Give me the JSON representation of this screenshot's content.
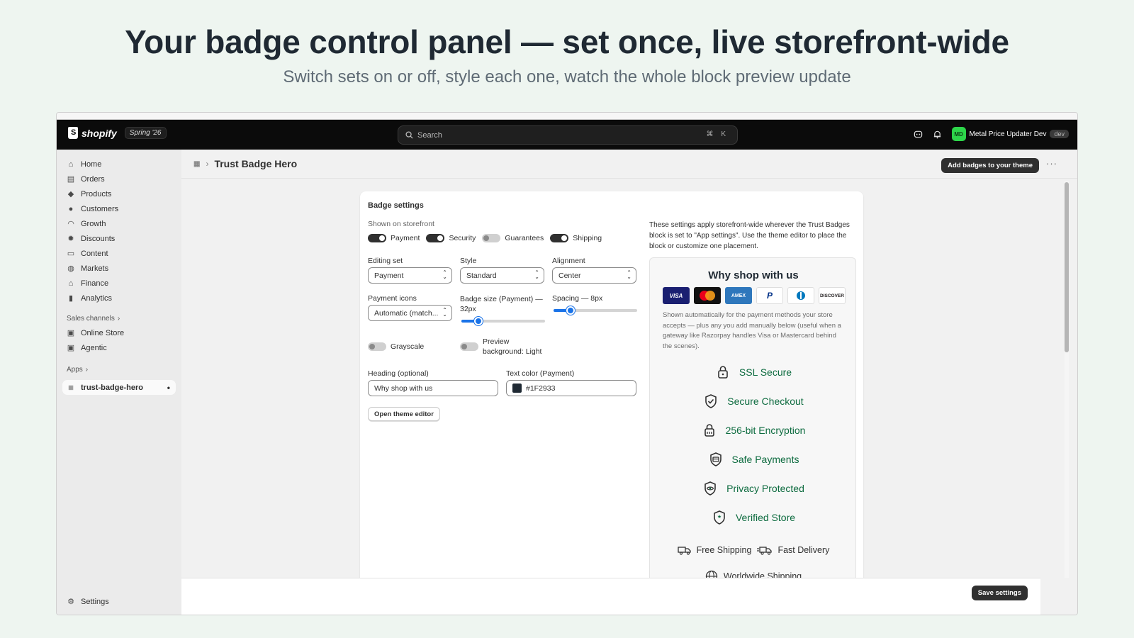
{
  "hero": {
    "title": "Your badge control panel — set once, live storefront-wide",
    "subtitle": "Switch sets on or off, style each one, watch the whole block preview update"
  },
  "topbar": {
    "brand": "shopify",
    "edition": "Spring '26",
    "search_placeholder": "Search",
    "search_shortcut": "⌘ K",
    "avatar_initials": "MD",
    "store_name": "Metal Price Updater Dev",
    "store_tag": "dev"
  },
  "sidebar": {
    "items": [
      {
        "label": "Home",
        "icon": "home-icon"
      },
      {
        "label": "Orders",
        "icon": "orders-icon"
      },
      {
        "label": "Products",
        "icon": "tag-icon"
      },
      {
        "label": "Customers",
        "icon": "person-icon"
      },
      {
        "label": "Growth",
        "icon": "gauge-icon"
      },
      {
        "label": "Discounts",
        "icon": "discount-icon"
      },
      {
        "label": "Content",
        "icon": "content-icon"
      },
      {
        "label": "Markets",
        "icon": "globe-icon"
      },
      {
        "label": "Finance",
        "icon": "bank-icon"
      },
      {
        "label": "Analytics",
        "icon": "bar-chart-icon"
      }
    ],
    "sales_channels_label": "Sales channels",
    "channels": [
      {
        "label": "Online Store",
        "icon": "store-icon"
      },
      {
        "label": "Agentic",
        "icon": "agentic-icon"
      }
    ],
    "apps_label": "Apps",
    "app_item": "trust-badge-hero",
    "settings_label": "Settings"
  },
  "page": {
    "title": "Trust Badge Hero",
    "add_button": "Add badges to your theme",
    "save_button": "Save settings"
  },
  "settings": {
    "card_title": "Badge settings",
    "shown_label": "Shown on storefront",
    "toggles": [
      {
        "label": "Payment",
        "on": true
      },
      {
        "label": "Security",
        "on": true
      },
      {
        "label": "Guarantees",
        "on": false
      },
      {
        "label": "Shipping",
        "on": true
      }
    ],
    "editing_set_label": "Editing set",
    "editing_set_value": "Payment",
    "style_label": "Style",
    "style_value": "Standard",
    "alignment_label": "Alignment",
    "alignment_value": "Center",
    "payment_icons_label": "Payment icons",
    "payment_icons_value": "Automatic (match...",
    "badge_size_label": "Badge size (Payment) — 32px",
    "badge_size_level": 0.2,
    "spacing_label": "Spacing — 8px",
    "spacing_level": 0.2,
    "grayscale_label": "Grayscale",
    "grayscale_on": false,
    "preview_bg_label": "Preview background: Light",
    "preview_bg_on": false,
    "heading_label": "Heading (optional)",
    "heading_value": "Why shop with us",
    "text_color_label": "Text color (Payment)",
    "text_color_value": "#1F2933",
    "theme_editor_button": "Open theme editor"
  },
  "preview": {
    "info": "These settings apply storefront-wide wherever the Trust Badges block is set to \"App settings\". Use the theme editor to place the block or customize one placement.",
    "heading": "Why shop with us",
    "payment_methods": [
      "VISA",
      "Mastercard",
      "AMEX",
      "PayPal",
      "Diners",
      "DISCOVER"
    ],
    "payment_note": "Shown automatically for the payment methods your store accepts — plus any you add manually below (useful when a gateway like Razorpay handles Visa or Mastercard behind the scenes).",
    "security_badges": [
      {
        "label": "SSL Secure",
        "icon": "padlock-icon"
      },
      {
        "label": "Secure Checkout",
        "icon": "shield-check-icon"
      },
      {
        "label": "256-bit Encryption",
        "icon": "encryption-lock-icon"
      },
      {
        "label": "Safe Payments",
        "icon": "shield-card-icon"
      },
      {
        "label": "Privacy Protected",
        "icon": "shield-eye-icon"
      },
      {
        "label": "Verified Store",
        "icon": "shield-star-icon"
      }
    ],
    "shipping": [
      {
        "label": "Free Shipping",
        "icon": "truck-icon"
      },
      {
        "label": "Fast Delivery",
        "icon": "fast-truck-icon"
      }
    ],
    "worldwide": "Worldwide Shipping",
    "badge_color": "#0d6b3f"
  }
}
